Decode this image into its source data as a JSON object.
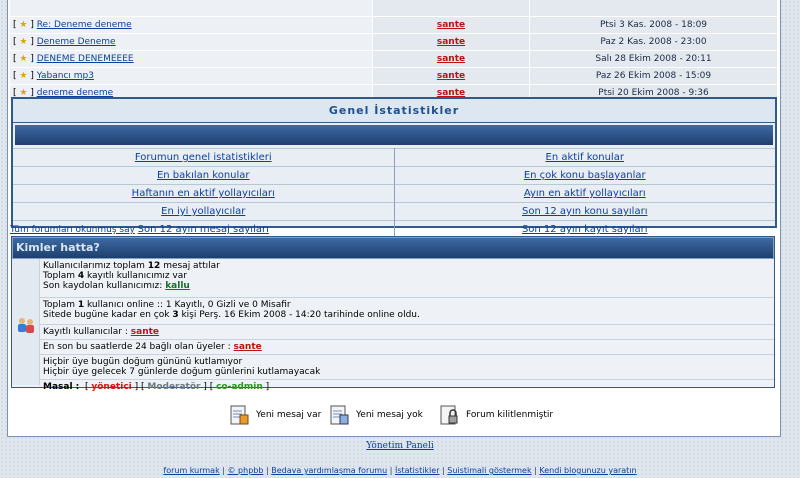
{
  "topics": [
    {
      "prefix": "[ ",
      "suffix": " ]",
      "title": "Re: Deneme deneme",
      "author": "sante",
      "date": "Ptsi 3 Kas. 2008 - 18:09"
    },
    {
      "prefix": "[ ",
      "suffix": " ]",
      "title": "Deneme Deneme",
      "author": "sante",
      "date": "Paz 2 Kas. 2008 - 23:00"
    },
    {
      "prefix": "[ ",
      "suffix": " ]",
      "title": "DENEME DENEMEEEE",
      "author": "sante",
      "date": "Salı 28 Ekim 2008 - 20:11"
    },
    {
      "prefix": "[ ",
      "suffix": " ]",
      "title": "Yabancı mp3",
      "author": "sante",
      "date": "Paz 26 Ekim 2008 - 15:09"
    },
    {
      "prefix": "[ ",
      "suffix": " ]",
      "title": "deneme deneme",
      "author": "sante",
      "date": "Ptsi 20 Ekim 2008 - 9:36"
    }
  ],
  "stats": {
    "title": "Genel İstatistikler",
    "links": [
      [
        "Forumun genel istatistikleri",
        "En aktif konular"
      ],
      [
        "En bakılan konular",
        "En çok konu başlayanlar"
      ],
      [
        "Haftanın en aktif yollayıcıları",
        "Ayın en aktif yollayıcıları"
      ],
      [
        "En iyi yollayıcılar",
        "Son 12 ayın konu sayıları"
      ],
      [
        "Son 12 ayın mesaj sayıları",
        "Son 12 ayın kayıt sayıları"
      ]
    ]
  },
  "mark_read": "Tüm forumları okunmuş say",
  "online": {
    "title": "Kimler hatta?",
    "l1a": "Kullanıcılarımız toplam ",
    "l1b": "12",
    "l1c": " mesaj attılar",
    "l2a": "Toplam ",
    "l2b": "4",
    "l2c": " kayıtlı kullanıcımız var",
    "l3a": "Son kaydolan kullanıcımız: ",
    "l3b": "kallu",
    "l4a": "Toplam ",
    "l4b": "1",
    "l4c": " kullanıcı online :: 1 Kayıtlı, 0 Gizli ve 0 Misafir",
    "l5a": "Sitede bugüne kadar en çok ",
    "l5b": "3",
    "l5c": " kişi Perş. 16 Ekim 2008 - 14:20 tarihinde online oldu.",
    "registered_label": "Kayıtlı kullanıcılar : ",
    "registered_user": "sante",
    "last24_label": "En son bu saatlerde 24 bağlı olan üyeler : ",
    "last24_user": "sante",
    "bday1": "Hiçbir üye bugün doğum gününü kutlamıyor",
    "bday2": "Hiçbir üye gelecek 7 günlerde doğum günlerini kutlamayacak",
    "mask_label": "Masal :",
    "ranks": {
      "admin": "yönetici",
      "mod": "Moderatör",
      "coadmin": "co-admin"
    }
  },
  "legend": [
    "Yeni mesaj var",
    "Yeni mesaj yok",
    "Forum kilitlenmiştir"
  ],
  "admin_panel": "Yönetim Paneli",
  "footer": [
    "forum kurmak",
    "© phpbb",
    "Bedava yardımlaşma forumu",
    "İstatistikler",
    "Suistimali göstermek",
    "Kendi blogunuzu yaratın"
  ]
}
